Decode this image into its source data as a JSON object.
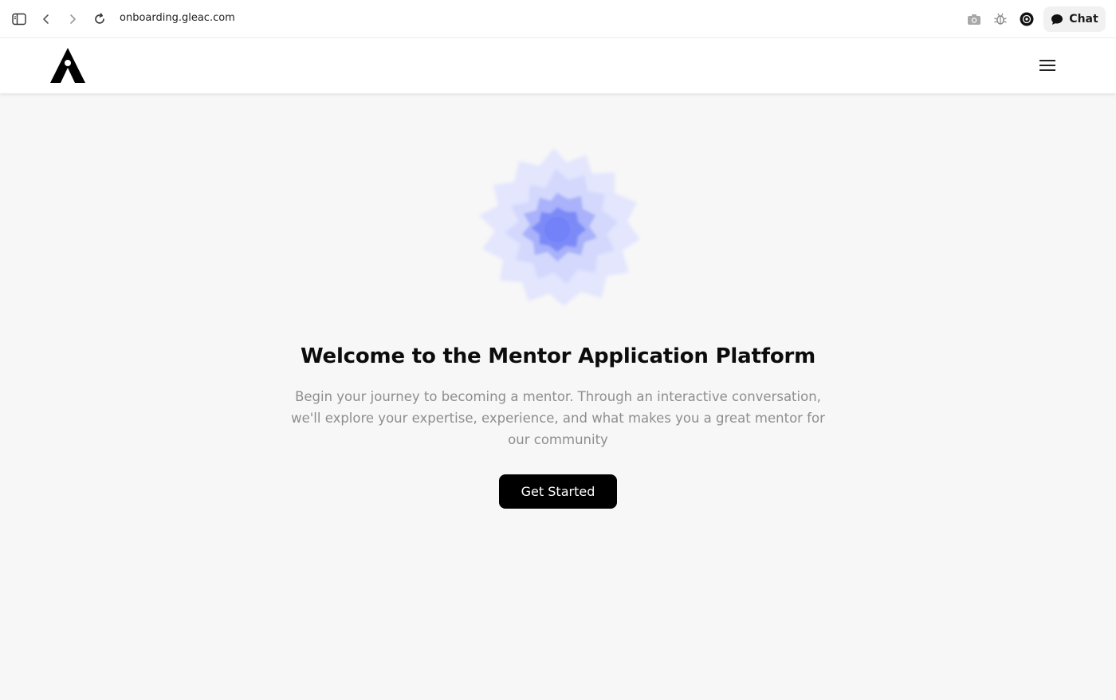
{
  "browser": {
    "url": "onboarding.gleac.com",
    "chat_label": "Chat"
  },
  "icons": {
    "sidebar": "sidebar-toggle-icon",
    "back": "chevron-left-icon",
    "forward": "chevron-right-icon",
    "reload": "reload-icon",
    "camera": "camera-icon",
    "bug": "bug-icon",
    "extension": "circle-extension-icon",
    "chat": "chat-bubble-icon",
    "menu": "hamburger-menu-icon",
    "logo": "letter-a-logo"
  },
  "colors": {
    "accent": "#6d7cff",
    "button": "#000000",
    "background": "#f7f7f7",
    "subtitle": "#8e8e8e"
  },
  "main": {
    "title": "Welcome to the Mentor Application Platform",
    "subtitle": "Begin your journey to becoming a mentor. Through an interactive conversation, we'll explore your expertise, experience, and what makes you a great mentor for our community",
    "cta_label": "Get Started"
  }
}
